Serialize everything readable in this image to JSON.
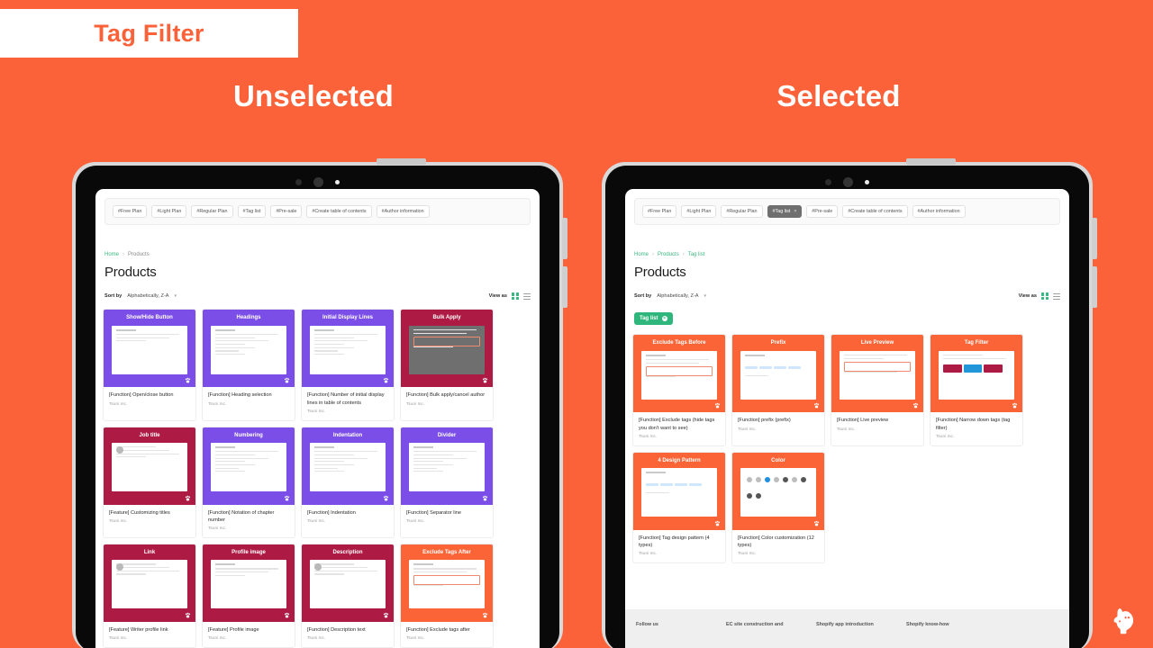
{
  "banner": {
    "title": "Tag Filter"
  },
  "columns": {
    "left_heading": "Unselected",
    "right_heading": "Selected"
  },
  "colors": {
    "background": "#FC6239",
    "accent_orange": "#FC6239",
    "purple": "#7C4EE8",
    "crimson": "#AD1B45",
    "green": "#2FB67C",
    "pill_active": "#6F6F6F"
  },
  "tag_bar": {
    "pills": [
      "#Free Plan",
      "#Light Plan",
      "#Regular Plan",
      "#Tag list",
      "#Pre-sale",
      "#Create table of contents",
      "#Author information"
    ],
    "active_pill": "#Tag list",
    "active_close": "×"
  },
  "left_screen": {
    "breadcrumb": [
      "Home",
      "Products"
    ],
    "breadcrumb_separator": "›",
    "page_title": "Products",
    "sort": {
      "label": "Sort by",
      "value": "Alphabetically, Z-A",
      "caret": "▾"
    },
    "view": {
      "label": "View as",
      "grid_icon": "grid-view-icon",
      "list_icon": "list-view-icon"
    },
    "products": [
      {
        "title": "Show/Hide Button",
        "theme": "purple",
        "shot": "doc",
        "name": "[Function] Open/close button",
        "vendor": "Tsuni Inc."
      },
      {
        "title": "Headings",
        "theme": "purple",
        "shot": "toc",
        "name": "[Function] Heading selection",
        "vendor": "Tsuni Inc."
      },
      {
        "title": "Initial Display Lines",
        "theme": "purple",
        "shot": "toc",
        "name": "[Function] Number of initial display lines in table of contents",
        "vendor": "Tsuni Inc."
      },
      {
        "title": "Bulk Apply",
        "theme": "crimson",
        "shot": "admin",
        "name": "[Function] Bulk apply/cancel author",
        "vendor": "Tsuni Inc."
      },
      {
        "title": "Job title",
        "theme": "crimson",
        "shot": "profile",
        "name": "[Feature] Customizing titles",
        "vendor": "Tsuni Inc."
      },
      {
        "title": "Numbering",
        "theme": "purple",
        "shot": "toc",
        "name": "[Function] Notation of chapter number",
        "vendor": "Tsuni Inc."
      },
      {
        "title": "Indentation",
        "theme": "purple",
        "shot": "toc",
        "name": "[Function] Indentation",
        "vendor": "Tsuni Inc."
      },
      {
        "title": "Divider",
        "theme": "purple",
        "shot": "toc",
        "name": "[Function] Separator line",
        "vendor": "Tsuni Inc."
      },
      {
        "title": "Link",
        "theme": "crimson",
        "shot": "profile",
        "name": "[Feature] Writer profile link",
        "vendor": "Tsuni Inc."
      },
      {
        "title": "Profile image",
        "theme": "crimson",
        "shot": "doc",
        "name": "[Feature] Profile image",
        "vendor": "Tsuni Inc."
      },
      {
        "title": "Description",
        "theme": "crimson",
        "shot": "profile",
        "name": "[Function] Description text",
        "vendor": "Tsuni Inc."
      },
      {
        "title": "Exclude Tags After",
        "theme": "orange",
        "shot": "tags",
        "name": "[Function] Exclude tags after",
        "vendor": "Tsuni Inc."
      }
    ]
  },
  "right_screen": {
    "breadcrumb": [
      "Home",
      "Products",
      "Tag list"
    ],
    "breadcrumb_separator": "›",
    "page_title": "Products",
    "sort": {
      "label": "Sort by",
      "value": "Alphabetically, Z-A",
      "caret": "▾"
    },
    "view": {
      "label": "View as",
      "grid_icon": "grid-view-icon",
      "list_icon": "list-view-icon"
    },
    "active_filter_chip": {
      "label": "Tag list",
      "remove": "×"
    },
    "products": [
      {
        "title": "Exclude Tags Before",
        "theme": "orange",
        "shot": "tags",
        "name": "[Function] Exclude tags (hide tags you don't want to see)",
        "vendor": "Tsuni Inc."
      },
      {
        "title": "Prefix",
        "theme": "orange",
        "shot": "chips",
        "name": "[Function] prefix (prefix)",
        "vendor": "Tsuni Inc."
      },
      {
        "title": "Live Preview",
        "theme": "orange",
        "shot": "editor",
        "name": "[Function] Live preview",
        "vendor": "Tsuni Inc."
      },
      {
        "title": "Tag Filter",
        "theme": "orange",
        "shot": "store",
        "name": "[Function] Narrow down tags (tag filter)",
        "vendor": "Tsuni Inc."
      },
      {
        "title": "4 Design Pattern",
        "theme": "orange",
        "shot": "chips",
        "name": "[Function] Tag design pattern (4 types)",
        "vendor": "Tsuni Inc."
      },
      {
        "title": "Color",
        "theme": "orange",
        "shot": "colors",
        "name": "[Function] Color customization (12 types)",
        "vendor": "Tsuni Inc."
      }
    ],
    "footer_columns": [
      "Follow us",
      "EC site construction and",
      "Shopify app introduction",
      "Shopify know-how"
    ]
  },
  "mascot": {
    "name": "dog-mascot-logo"
  }
}
